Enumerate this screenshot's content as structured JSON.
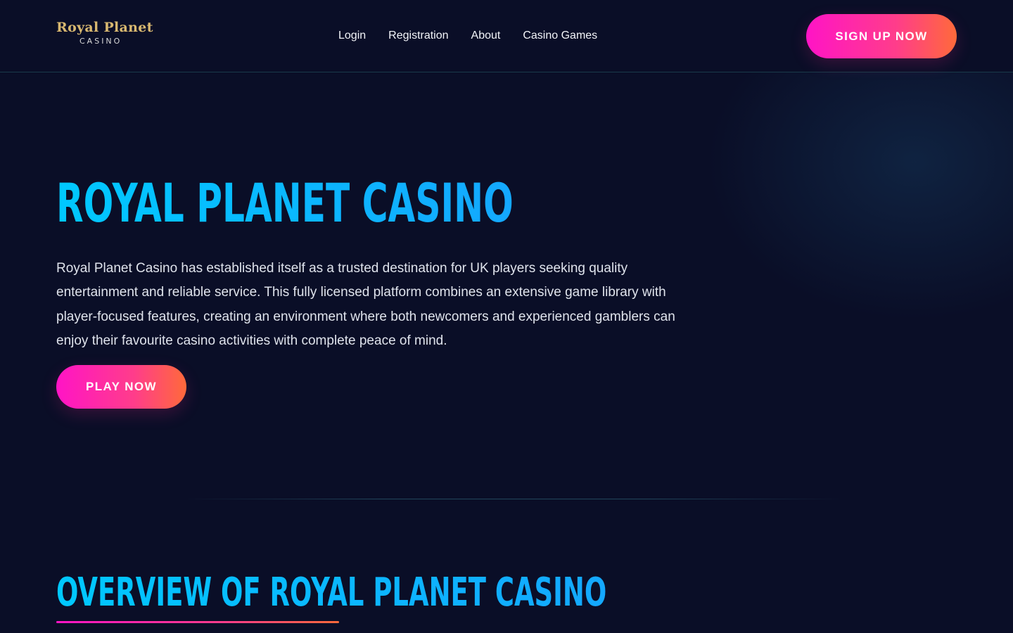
{
  "brand": {
    "logo_main": "Royal Planet",
    "logo_sub": "CASINO",
    "accent_gradient": [
      "#ff14c6",
      "#ff6a3a"
    ],
    "title_color": "#00c8ff",
    "background": "#0a0e27"
  },
  "nav": {
    "items": [
      {
        "label": "Login"
      },
      {
        "label": "Registration"
      },
      {
        "label": "About"
      },
      {
        "label": "Casino Games"
      }
    ]
  },
  "header": {
    "cta_label": "SIGN UP NOW"
  },
  "hero": {
    "title": "ROYAL PLANET CASINO",
    "text": "Royal Planet Casino has established itself as a trusted destination for UK players seeking quality entertainment and reliable service. This fully licensed platform combines an extensive game library with player-focused features, creating an environment where both newcomers and experienced gamblers can enjoy their favourite casino activities with complete peace of mind.",
    "cta_label": "PLAY NOW"
  },
  "overview": {
    "title": "OVERVIEW OF ROYAL PLANET CASINO"
  }
}
